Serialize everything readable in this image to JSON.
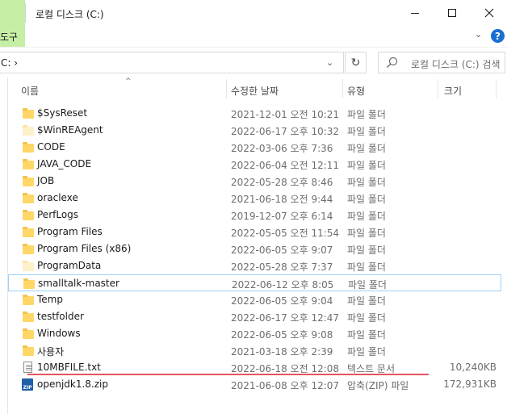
{
  "window": {
    "title": "로컬 디스크 (C:)"
  },
  "ribbon": {
    "tab_label": "도구"
  },
  "address": {
    "path": "C:  ›",
    "search_placeholder": "로컬 디스크 (C:) 검색"
  },
  "columns": {
    "name": "이름",
    "date": "수정한 날짜",
    "type": "유형",
    "size": "크기"
  },
  "colors": {
    "folder": "#ffd767",
    "selection_border": "#99d1ff",
    "annotation_red": "#e8525f",
    "ribbon_green": "#c6efa5",
    "help_blue": "#1a6fd1"
  },
  "files": [
    {
      "name": "$SysReset",
      "date": "2021-12-01 오전 10:21",
      "type": "파일 폴더",
      "size": "",
      "icon": "folder-icon"
    },
    {
      "name": "$WinREAgent",
      "date": "2022-06-17 오후 10:32",
      "type": "파일 폴더",
      "size": "",
      "icon": "folder-faded-icon"
    },
    {
      "name": "CODE",
      "date": "2022-03-06 오후 7:36",
      "type": "파일 폴더",
      "size": "",
      "icon": "folder-icon"
    },
    {
      "name": "JAVA_CODE",
      "date": "2022-06-04 오전 12:11",
      "type": "파일 폴더",
      "size": "",
      "icon": "folder-icon"
    },
    {
      "name": "JOB",
      "date": "2022-05-28 오후 8:46",
      "type": "파일 폴더",
      "size": "",
      "icon": "folder-icon"
    },
    {
      "name": "oraclexe",
      "date": "2021-06-18 오전 9:44",
      "type": "파일 폴더",
      "size": "",
      "icon": "folder-icon"
    },
    {
      "name": "PerfLogs",
      "date": "2019-12-07 오후 6:14",
      "type": "파일 폴더",
      "size": "",
      "icon": "folder-icon"
    },
    {
      "name": "Program Files",
      "date": "2022-05-05 오전 11:54",
      "type": "파일 폴더",
      "size": "",
      "icon": "folder-icon"
    },
    {
      "name": "Program Files (x86)",
      "date": "2022-06-05 오후 9:07",
      "type": "파일 폴더",
      "size": "",
      "icon": "folder-icon"
    },
    {
      "name": "ProgramData",
      "date": "2022-05-28 오후 7:37",
      "type": "파일 폴더",
      "size": "",
      "icon": "folder-faded-icon"
    },
    {
      "name": "smalltalk-master",
      "date": "2022-06-12 오후 8:05",
      "type": "파일 폴더",
      "size": "",
      "icon": "folder-icon",
      "selected": true
    },
    {
      "name": "Temp",
      "date": "2022-06-05 오후 9:04",
      "type": "파일 폴더",
      "size": "",
      "icon": "folder-icon"
    },
    {
      "name": "testfolder",
      "date": "2022-06-17 오후 12:47",
      "type": "파일 폴더",
      "size": "",
      "icon": "folder-icon"
    },
    {
      "name": "Windows",
      "date": "2022-06-05 오후 9:08",
      "type": "파일 폴더",
      "size": "",
      "icon": "folder-icon"
    },
    {
      "name": "사용자",
      "date": "2021-03-18 오후 2:39",
      "type": "파일 폴더",
      "size": "",
      "icon": "folder-icon"
    },
    {
      "name": "10MBFILE.txt",
      "date": "2022-06-18 오전 12:08",
      "type": "텍스트 문서",
      "size": "10,240KB",
      "icon": "text-file-icon"
    },
    {
      "name": "openjdk1.8.zip",
      "date": "2021-06-08 오후 12:07",
      "type": "압축(ZIP) 파일",
      "size": "172,931KB",
      "icon": "zip-file-icon",
      "icon_text": "ZIP"
    }
  ]
}
